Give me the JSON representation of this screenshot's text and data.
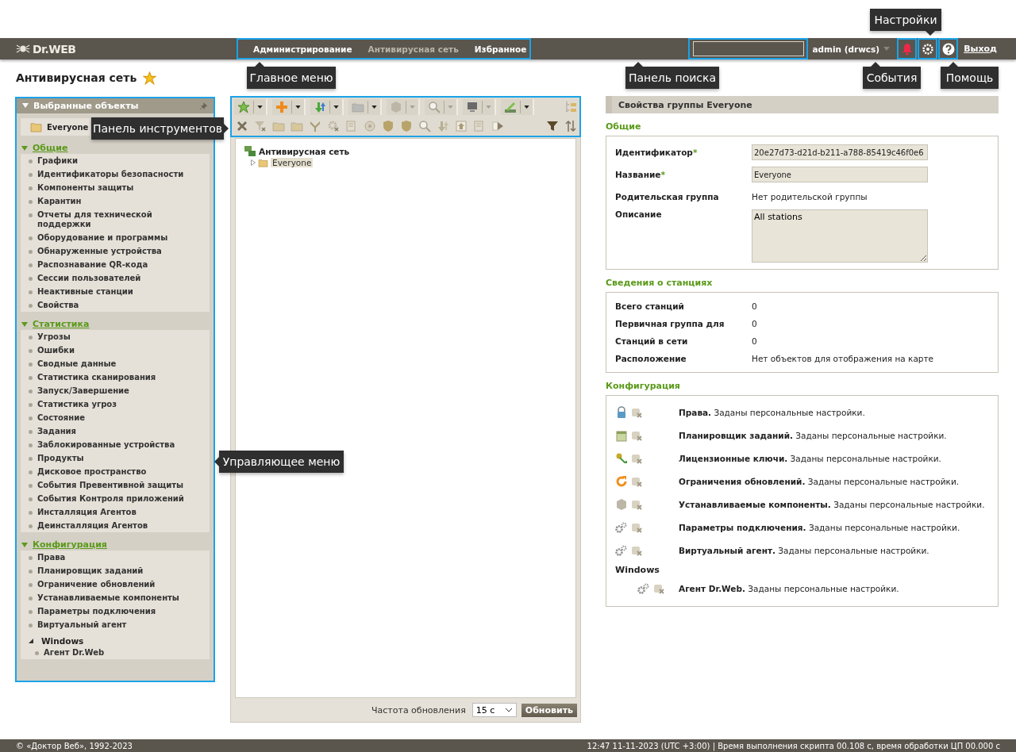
{
  "header": {
    "logo": "Dr.WEB",
    "main_menu": [
      {
        "label": "Администрирование",
        "selected": false
      },
      {
        "label": "Антивирусная сеть",
        "selected": true
      },
      {
        "label": "Избранное",
        "selected": false
      }
    ],
    "user": "admin (drwcs)",
    "logout": "Выход"
  },
  "page_title": {
    "text": "Антивирусная сеть",
    "favorite": true
  },
  "left_panel": {
    "title": "Выбранные объекты",
    "selected_object": "Everyone",
    "sections": [
      {
        "title": "Общие",
        "expanded": true,
        "items": [
          {
            "label": "Графики"
          },
          {
            "label": "Идентификаторы безопасности"
          },
          {
            "label": "Компоненты защиты"
          },
          {
            "label": "Карантин"
          },
          {
            "label": "Отчеты для технической поддержки"
          },
          {
            "label": "Оборудование и программы"
          },
          {
            "label": "Обнаруженные устройства"
          },
          {
            "label": "Распознавание QR-кода"
          },
          {
            "label": "Сессии пользователей"
          },
          {
            "label": "Неактивные станции"
          },
          {
            "label": "Свойства"
          }
        ]
      },
      {
        "title": "Статистика",
        "expanded": true,
        "items": [
          {
            "label": "Угрозы"
          },
          {
            "label": "Ошибки"
          },
          {
            "label": "Сводные данные"
          },
          {
            "label": "Статистика сканирования"
          },
          {
            "label": "Запуск/Завершение"
          },
          {
            "label": "Статистика угроз"
          },
          {
            "label": "Состояние"
          },
          {
            "label": "Задания"
          },
          {
            "label": "Заблокированные устройства"
          },
          {
            "label": "Продукты"
          },
          {
            "label": "Дисковое пространство"
          },
          {
            "label": "События Превентивной защиты"
          },
          {
            "label": "События Контроля приложений"
          },
          {
            "label": "Инсталляция Агентов"
          },
          {
            "label": "Деинсталляция Агентов"
          }
        ]
      },
      {
        "title": "Конфигурация",
        "expanded": true,
        "items": [
          {
            "label": "Права"
          },
          {
            "label": "Планировщик заданий"
          },
          {
            "label": "Ограничение обновлений"
          },
          {
            "label": "Устанавливаемые компоненты"
          },
          {
            "label": "Параметры подключения"
          },
          {
            "label": "Виртуальный агент"
          },
          {
            "label": "Windows",
            "expanded": true,
            "children": [
              {
                "label": "Агент Dr.Web"
              }
            ]
          }
        ]
      }
    ]
  },
  "network_tree": {
    "root": "Антивирусная сеть",
    "children": [
      {
        "label": "Everyone",
        "selected": true,
        "expanded": false
      }
    ],
    "refresh_label": "Частота обновления",
    "refresh_value": "15 с",
    "refresh_button": "Обновить"
  },
  "properties": {
    "title": "Свойства группы Everyone",
    "general": {
      "title": "Общие",
      "fields": [
        {
          "label": "Идентификатор",
          "required_mark": "*",
          "kind": "input",
          "value": "20e27d73-d21d-b211-a788-85419c46f0e6"
        },
        {
          "label": "Название",
          "required_mark": "*",
          "kind": "input",
          "value": "Everyone"
        },
        {
          "label": "Родительская группа",
          "kind": "text",
          "value": "Нет родительской группы"
        },
        {
          "label": "Описание",
          "kind": "textarea",
          "value": "All stations"
        }
      ]
    },
    "stations": {
      "title": "Сведения о станциях",
      "rows": [
        {
          "label": "Всего станций",
          "value": "0"
        },
        {
          "label": "Первичная группа для",
          "value": "0"
        },
        {
          "label": "Станций в сети",
          "value": "0"
        },
        {
          "label": "Расположение",
          "value": "Нет объектов для отображения на карте"
        }
      ]
    },
    "configuration": {
      "title": "Конфигурация",
      "items": [
        {
          "text": "**Права.** Заданы персональные настройки."
        },
        {
          "text": "**Планировщик заданий.** Заданы персональные настройки."
        },
        {
          "text": "**Лицензионные ключи.** Заданы персональные настройки."
        },
        {
          "text": "**Ограничения обновлений.** Заданы персональные настройки."
        },
        {
          "text": "**Устанавливаемые компоненты.** Заданы персональные настройки."
        },
        {
          "text": "**Параметры подключения.** Заданы персональные настройки."
        },
        {
          "text": "**Виртуальный агент.** Заданы персональные настройки."
        }
      ],
      "groups": [
        {
          "title": "Windows",
          "items": [
            {
              "text": "**Агент Dr.Web.** Заданы персональные настройки."
            }
          ]
        }
      ]
    }
  },
  "annotations": [
    {
      "text": "Главное меню"
    },
    {
      "text": "Панель инструментов"
    },
    {
      "text": "Панель поиска"
    },
    {
      "text": "Настройки"
    },
    {
      "text": "События"
    },
    {
      "text": "Помощь"
    },
    {
      "text": "Управляющее меню"
    }
  ],
  "footer": {
    "copyright": "© «Доктор Веб», 1992-2023",
    "status": "12:47 11-11-2023 (UTC +3:00) | Время выполнения скрипта 00.108 с, время обработки ЦП 00.000 с"
  }
}
